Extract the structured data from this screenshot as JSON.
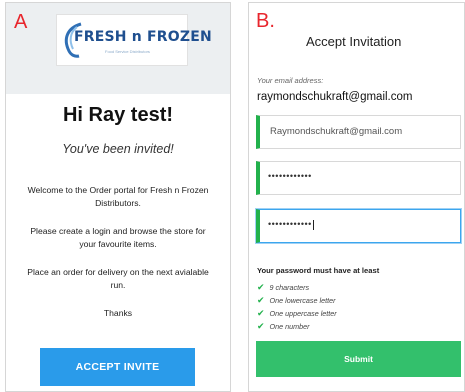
{
  "panel_a": {
    "label": "A",
    "logo": {
      "name": "FRESH n FROZEN",
      "tagline": "Food Service Distributors",
      "icon": "swirl-logo-icon",
      "brand_color": "#1f4f8f"
    },
    "heading": "Hi Ray test!",
    "subheading": "You've been invited!",
    "paragraphs": [
      "Welcome to the Order portal for Fresh n Frozen Distributors.",
      "Please create a login and browse the store for your favourite items.",
      "Place an order for delivery on the next avialable run.",
      "Thanks"
    ],
    "button_label": "ACCEPT INVITE",
    "button_color": "#2a9bea"
  },
  "panel_b": {
    "label": "B.",
    "title": "Accept Invitation",
    "email_label": "Your email address:",
    "email_value": "raymondschukraft@gmail.com",
    "fields": [
      {
        "value": "Raymondschukraft@gmail.com"
      },
      {
        "value": "••••••••••••"
      },
      {
        "value": "••••••••••••"
      }
    ],
    "requirements_title": "Your password must have at least",
    "requirements": [
      "9 characters",
      "One lowercase letter",
      "One uppercase letter",
      "One number"
    ],
    "check_icon": "check-icon",
    "submit_label": "Submit",
    "submit_color": "#33c06c",
    "accent_color": "#22b14c"
  }
}
